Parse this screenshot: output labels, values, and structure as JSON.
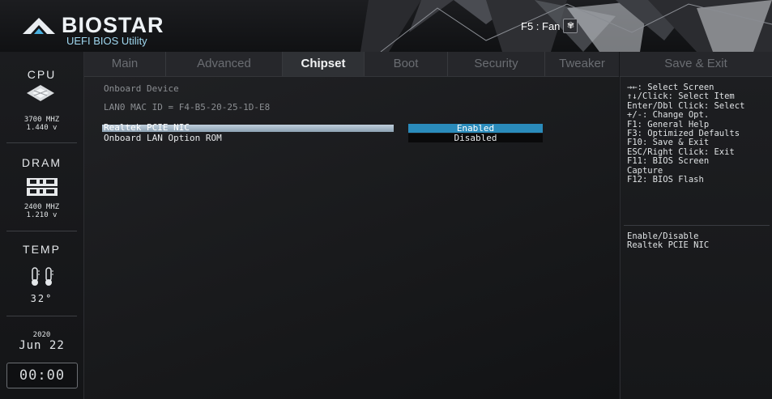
{
  "header": {
    "brand": "BIOSTAR",
    "subtitle": "UEFI BIOS Utility",
    "fan_hint": "F5 : Fan",
    "fan_icon": "fan-icon"
  },
  "sidebar": {
    "cpu": {
      "title": "CPU",
      "freq": "3700 MHZ",
      "voltage": "1.440 v"
    },
    "dram": {
      "title": "DRAM",
      "freq": "2400 MHZ",
      "voltage": "1.210 v"
    },
    "temp": {
      "title": "TEMP",
      "value": "32°"
    },
    "date": {
      "year": "2020",
      "day": "Jun 22"
    },
    "clock": "00:00"
  },
  "tabs": [
    {
      "label": "Main",
      "active": false
    },
    {
      "label": "Advanced",
      "active": false
    },
    {
      "label": "Chipset",
      "active": true
    },
    {
      "label": "Boot",
      "active": false
    },
    {
      "label": "Security",
      "active": false
    },
    {
      "label": "Tweaker",
      "active": false
    }
  ],
  "save_exit_tab": "Save & Exit",
  "main": {
    "section_title": "Onboard Device",
    "mac_line": "LAN0 MAC ID = F4-B5-20-25-1D-E8",
    "items": [
      {
        "label": "Realtek PCIE NIC",
        "value": "Enabled"
      },
      {
        "label": "Onboard LAN Option ROM",
        "value": "Disabled"
      }
    ]
  },
  "help": [
    "→←: Select Screen",
    "↑↓/Click: Select Item",
    "Enter/Dbl Click: Select",
    "+/-: Change Opt.",
    "F1: General Help",
    "F3: Optimized Defaults",
    "F10: Save & Exit",
    "ESC/Right Click: Exit",
    "F11: BIOS Screen",
    "Capture",
    "F12: BIOS Flash"
  ],
  "description": [
    "Enable/Disable",
    "Realtek PCIE NIC"
  ],
  "colors": {
    "accent": "#2a8bbb",
    "selected_bar": "#a6b8c6",
    "logo_sub": "#9fd7ef"
  }
}
